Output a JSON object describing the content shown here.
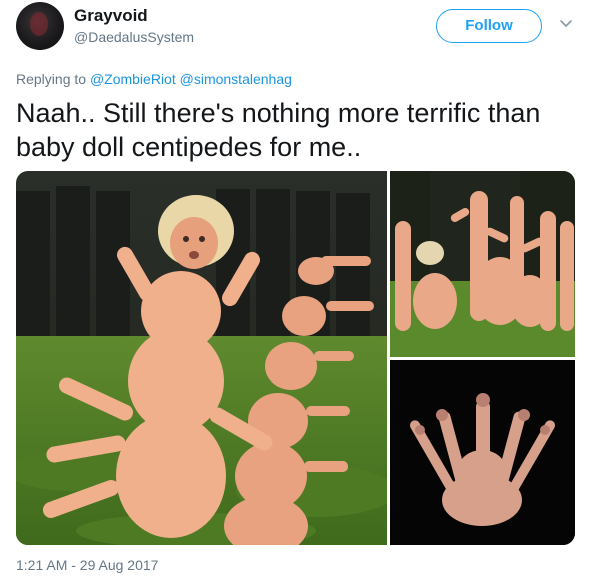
{
  "user": {
    "display_name": "Grayvoid",
    "screen_name": "@DaedalusSystem",
    "avatar_icon": "avatar-image"
  },
  "actions": {
    "follow_label": "Follow",
    "more_icon": "chevron-down-icon"
  },
  "reply": {
    "prefix": "Replying to",
    "mentions": [
      "@ZombieRiot",
      "@simonstalenhag"
    ]
  },
  "tweet": {
    "text": "Naah.. Still there's nothing more terrific than baby doll centipedes for me.."
  },
  "media": {
    "photos": [
      {
        "id": "photo-1",
        "alt": ""
      },
      {
        "id": "photo-2",
        "alt": ""
      },
      {
        "id": "photo-3",
        "alt": ""
      }
    ]
  },
  "meta": {
    "timestamp": "1:21 AM - 29 Aug 2017"
  },
  "colors": {
    "accent": "#1da1f2",
    "link": "#1b95e0",
    "secondary_text": "#657786",
    "primary_text": "#14171a"
  }
}
